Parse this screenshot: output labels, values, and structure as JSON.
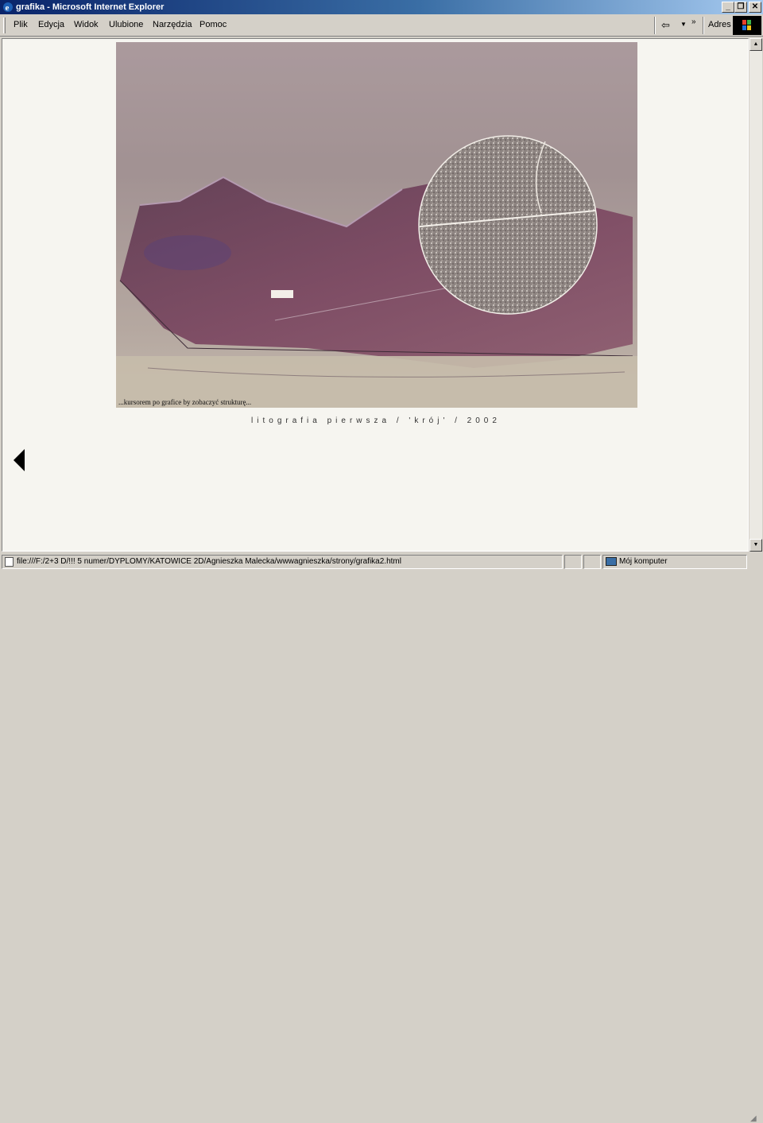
{
  "window": {
    "title": "grafika - Microsoft Internet Explorer",
    "min_label": "_",
    "max_label": "❐",
    "close_label": "✕"
  },
  "menu": {
    "items": [
      "Plik",
      "Edycja",
      "Widok",
      "Ulubione",
      "Narzędzia",
      "Pomoc"
    ],
    "back_glyph": "⇦",
    "dropdown_glyph": "▼",
    "more_glyph": "»",
    "address_label": "Adres"
  },
  "page": {
    "artwork_hint": "...kursorem po grafice by zobaczyć strukturę...",
    "caption": "litografia pierwsza / 'krój' / 2002"
  },
  "scrollbar": {
    "up_glyph": "▲",
    "down_glyph": "▼"
  },
  "status": {
    "path": "file:///F:/2+3 D/!!! 5 numer/DYPLOMY/KATOWICE 2D/Agnieszka Malecka/wwwagnieszka/strony/grafika2.html",
    "zone": "Mój komputer"
  },
  "colors": {
    "titlebar_start": "#0a246a",
    "titlebar_end": "#a6caf0",
    "chrome": "#d4d0c8",
    "page_bg": "#f6f5f0",
    "print_plum": "#7a4660",
    "print_paper": "#c4b8b4"
  }
}
